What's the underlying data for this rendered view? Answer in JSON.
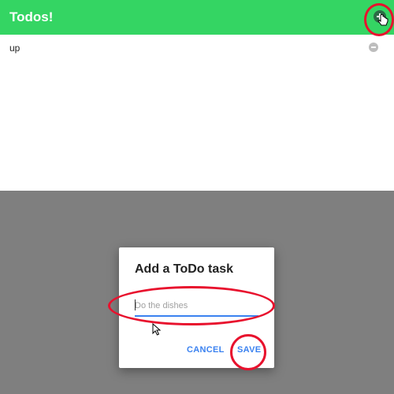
{
  "appbar": {
    "title": "Todos!",
    "add_icon": "plus-circle-icon"
  },
  "todos": [
    {
      "text": "up",
      "remove_icon": "minus-circle-icon"
    }
  ],
  "dialog": {
    "title": "Add a ToDo task",
    "input_value": "",
    "input_placeholder": "Do the dishes",
    "cancel_label": "CANCEL",
    "save_label": "SAVE"
  },
  "colors": {
    "appbar": "#34d563",
    "accent": "#3b82f0",
    "scrim": "#7f7f7f",
    "annotation": "#e8112d"
  }
}
